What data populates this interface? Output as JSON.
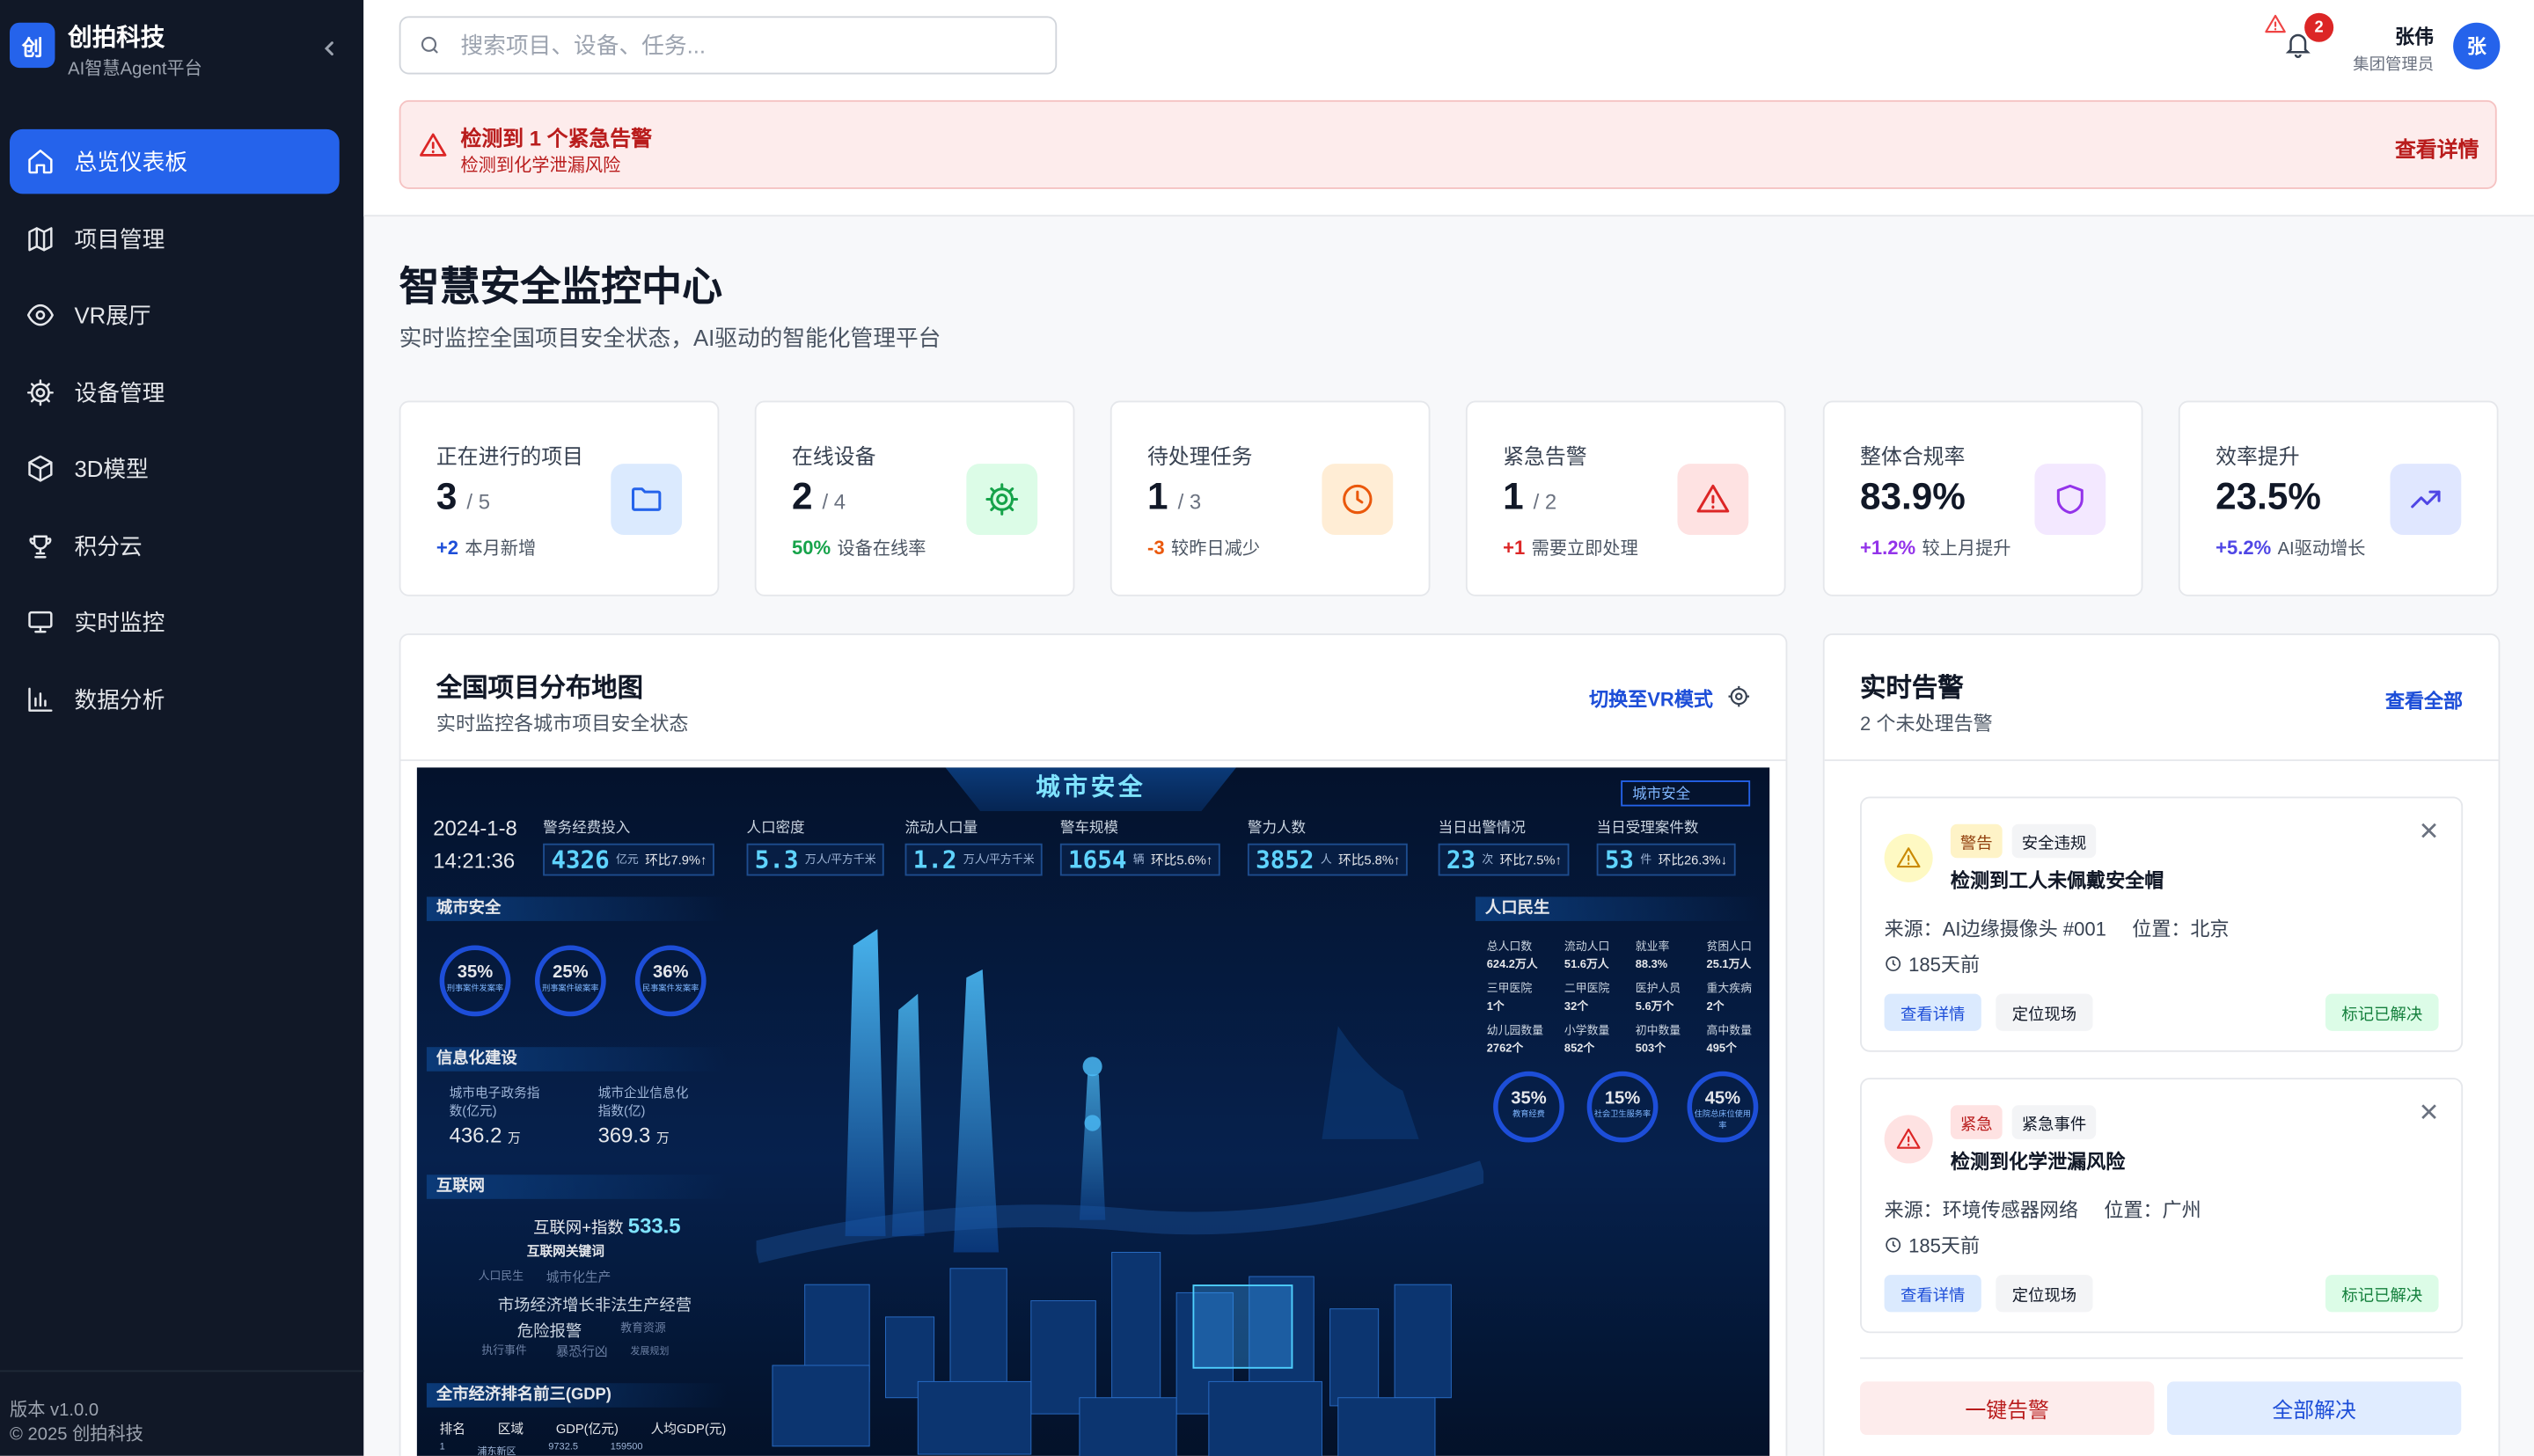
{
  "brand": {
    "logo_char": "创",
    "name": "创拍科技",
    "subtitle": "AI智慧Agent平台"
  },
  "nav": [
    {
      "label": "总览仪表板",
      "icon": "home-icon",
      "active": true
    },
    {
      "label": "项目管理",
      "icon": "map-icon"
    },
    {
      "label": "VR展厅",
      "icon": "eye-icon"
    },
    {
      "label": "设备管理",
      "icon": "gear-icon"
    },
    {
      "label": "3D模型",
      "icon": "cube-icon"
    },
    {
      "label": "积分云",
      "icon": "trophy-icon"
    },
    {
      "label": "实时监控",
      "icon": "monitor-icon"
    },
    {
      "label": "数据分析",
      "icon": "bar-chart-icon"
    }
  ],
  "footer": {
    "version": "版本 v1.0.0",
    "copyright": "© 2025 创拍科技"
  },
  "search": {
    "placeholder": "搜索项目、设备、任务..."
  },
  "notifications": {
    "count": "2"
  },
  "user": {
    "name": "张伟",
    "role": "集团管理员",
    "avatar": "张"
  },
  "alert_banner": {
    "title": "检测到 1 个紧急告警",
    "subtitle": "检测到化学泄漏风险",
    "link": "查看详情"
  },
  "page": {
    "title": "智慧安全监控中心",
    "subtitle": "实时监控全国项目安全状态，AI驱动的智能化管理平台"
  },
  "stats": [
    {
      "label": "正在进行的项目",
      "value": "3",
      "total": "/ 5",
      "delta": "+2",
      "delta_text": "本月新增",
      "delta_color": "#1d4ed8",
      "icon": "folder-icon",
      "icon_color": "#2563eb",
      "icon_bg": "#dbeafe"
    },
    {
      "label": "在线设备",
      "value": "2",
      "total": "/ 4",
      "delta": "50%",
      "delta_text": "设备在线率",
      "delta_color": "#16a34a",
      "icon": "gear-icon",
      "icon_color": "#16a34a",
      "icon_bg": "#dcfce7"
    },
    {
      "label": "待处理任务",
      "value": "1",
      "total": "/ 3",
      "delta": "-3",
      "delta_text": "较昨日减少",
      "delta_color": "#ea580c",
      "icon": "clock-icon",
      "icon_color": "#ea580c",
      "icon_bg": "#ffedd5"
    },
    {
      "label": "紧急告警",
      "value": "1",
      "total": "/ 2",
      "delta": "+1",
      "delta_text": "需要立即处理",
      "delta_color": "#dc2626",
      "icon": "warning-icon",
      "icon_color": "#dc2626",
      "icon_bg": "#fee2e2"
    },
    {
      "label": "整体合规率",
      "value": "83.9%",
      "total": "",
      "delta": "+1.2%",
      "delta_text": "较上月提升",
      "delta_color": "#9333ea",
      "icon": "shield-icon",
      "icon_color": "#9333ea",
      "icon_bg": "#f3e8ff"
    },
    {
      "label": "效率提升",
      "value": "23.5%",
      "total": "",
      "delta": "+5.2%",
      "delta_text": "AI驱动增长",
      "delta_color": "#4f46e5",
      "icon": "trending-up-icon",
      "icon_color": "#4f46e5",
      "icon_bg": "#e0e7ff"
    }
  ],
  "map_card": {
    "title": "全国项目分布地图",
    "subtitle": "实时监控各城市项目安全状态",
    "link": "切换至VR模式",
    "vr": {
      "title": "城市安全",
      "dropdown": "城市安全",
      "date": "2024-1-8",
      "time": "14:21:36",
      "kpis": [
        {
          "label": "警务经费投入",
          "value": "4326",
          "unit": "亿元",
          "change": "环比7.9%↑"
        },
        {
          "label": "人口密度",
          "value": "5.3",
          "unit": "万人/平方千米",
          "change": ""
        },
        {
          "label": "流动人口量",
          "value": "1.2",
          "unit": "万人/平方千米",
          "change": ""
        },
        {
          "label": "警车规模",
          "value": "1654",
          "unit": "辆",
          "change": "环比5.6%↑"
        },
        {
          "label": "警力人数",
          "value": "3852",
          "unit": "人",
          "change": "环比5.8%↑"
        },
        {
          "label": "当日出警情况",
          "value": "23",
          "unit": "次",
          "change": "环比7.5%↑"
        },
        {
          "label": "当日受理案件数",
          "value": "53",
          "unit": "件",
          "change": "环比26.3%↓"
        }
      ],
      "sections": {
        "city_safety": "城市安全",
        "informatization": "信息化建设",
        "internet": "互联网",
        "gdp_rank": "全市经济排名前三(GDP)",
        "population": "人口民生"
      },
      "gauges_left": [
        {
          "value": "35%",
          "label": "刑事案件发案率"
        },
        {
          "value": "25%",
          "label": "刑事案件破案率"
        },
        {
          "value": "36%",
          "label": "民事案件发案率"
        }
      ],
      "info_left": [
        {
          "label": "城市电子政务指数(亿元)",
          "value": "436.2",
          "unit": "万"
        },
        {
          "label": "城市企业信息化指数(亿)",
          "value": "369.3",
          "unit": "万"
        }
      ],
      "internet": {
        "index_label": "互联网+指数",
        "index_value": "533.5",
        "keywords_title": "互联网关键词",
        "keywords": [
          "人口民生",
          "城市化生产",
          "市场经济增长非法生产经营",
          "危险报警",
          "教育资源",
          "执行事件",
          "暴恐行凶",
          "发展规划"
        ]
      },
      "gdp_table": {
        "headers": [
          "排名",
          "区域",
          "GDP(亿元)",
          "人均GDP(元)"
        ],
        "row": [
          "1",
          "浦东新区",
          "9732.5",
          "159500"
        ]
      },
      "population_grid": [
        {
          "label": "总人口数",
          "value": "624.2万人"
        },
        {
          "label": "流动人口",
          "value": "51.6万人"
        },
        {
          "label": "就业率",
          "value": "88.3%"
        },
        {
          "label": "贫困人口",
          "value": "25.1万人"
        },
        {
          "label": "三甲医院",
          "value": "1个"
        },
        {
          "label": "二甲医院",
          "value": "32个"
        },
        {
          "label": "医护人员",
          "value": "5.6万个"
        },
        {
          "label": "重大疾病",
          "value": "2个"
        },
        {
          "label": "幼儿园数量",
          "value": "2762个"
        },
        {
          "label": "小学数量",
          "value": "852个"
        },
        {
          "label": "初中数量",
          "value": "503个"
        },
        {
          "label": "高中数量",
          "value": "495个"
        }
      ],
      "gauges_right": [
        {
          "value": "35%",
          "label": "教育经费"
        },
        {
          "value": "15%",
          "label": "社会卫生服务率"
        },
        {
          "value": "45%",
          "label": "住院总床位使用率"
        }
      ]
    }
  },
  "alerts_card": {
    "title": "实时告警",
    "subtitle": "2 个未处理告警",
    "link": "查看全部",
    "items": [
      {
        "level": "警告",
        "category": "安全违规",
        "title": "检测到工人未佩戴安全帽",
        "source": "来源：AI边缘摄像头 #001",
        "location": "位置：北京",
        "time": "185天前",
        "level_bg": "#fef3c7",
        "level_color": "#92400e",
        "icon_color": "#ca8a04",
        "icon_bg": "#fef9c3"
      },
      {
        "level": "紧急",
        "category": "紧急事件",
        "title": "检测到化学泄漏风险",
        "source": "来源：环境传感器网络",
        "location": "位置：广州",
        "time": "185天前",
        "level_bg": "#fee2e2",
        "level_color": "#b91c1c",
        "icon_color": "#dc2626",
        "icon_bg": "#fee2e2"
      }
    ],
    "actions": {
      "view": "查看详情",
      "locate": "定位现场",
      "resolve": "标记已解决"
    },
    "footer": {
      "alarm": "一键告警",
      "resolve_all": "全部解决"
    }
  }
}
